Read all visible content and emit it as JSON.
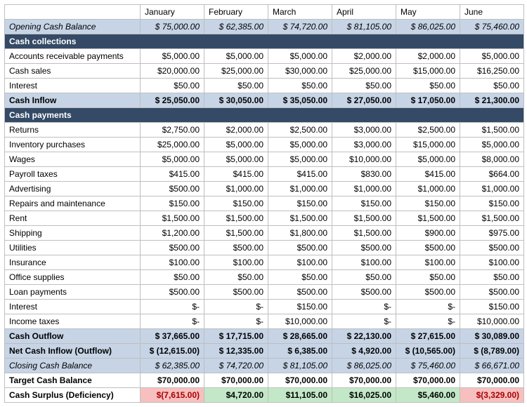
{
  "months": [
    "January",
    "February",
    "March",
    "April",
    "May",
    "June"
  ],
  "rows": {
    "opening": {
      "label": "Opening Cash Balance",
      "vals": [
        "$  75,000.00",
        "$  62,385.00",
        "$  74,720.00",
        "$  81,105.00",
        "$  86,025.00",
        "$  75,460.00"
      ]
    },
    "sec_collect": {
      "label": "Cash collections"
    },
    "ar": {
      "label": "Accounts receivable payments",
      "vals": [
        "$5,000.00",
        "$5,000.00",
        "$5,000.00",
        "$2,000.00",
        "$2,000.00",
        "$5,000.00"
      ]
    },
    "cashsales": {
      "label": "Cash sales",
      "vals": [
        "$20,000.00",
        "$25,000.00",
        "$30,000.00",
        "$25,000.00",
        "$15,000.00",
        "$16,250.00"
      ]
    },
    "interest_in": {
      "label": "Interest",
      "vals": [
        "$50.00",
        "$50.00",
        "$50.00",
        "$50.00",
        "$50.00",
        "$50.00"
      ]
    },
    "inflow": {
      "label": "Cash Inflow",
      "vals": [
        "$  25,050.00",
        "$  30,050.00",
        "$   35,050.00",
        "$   27,050.00",
        "$   17,050.00",
        "$   21,300.00"
      ]
    },
    "sec_pay": {
      "label": "Cash payments"
    },
    "returns": {
      "label": "Returns",
      "vals": [
        "$2,750.00",
        "$2,000.00",
        "$2,500.00",
        "$3,000.00",
        "$2,500.00",
        "$1,500.00"
      ]
    },
    "inventory": {
      "label": "Inventory purchases",
      "vals": [
        "$25,000.00",
        "$5,000.00",
        "$5,000.00",
        "$3,000.00",
        "$15,000.00",
        "$5,000.00"
      ]
    },
    "wages": {
      "label": "Wages",
      "vals": [
        "$5,000.00",
        "$5,000.00",
        "$5,000.00",
        "$10,000.00",
        "$5,000.00",
        "$8,000.00"
      ]
    },
    "payroll": {
      "label": "Payroll taxes",
      "vals": [
        "$415.00",
        "$415.00",
        "$415.00",
        "$830.00",
        "$415.00",
        "$664.00"
      ]
    },
    "adv": {
      "label": "Advertising",
      "vals": [
        "$500.00",
        "$1,000.00",
        "$1,000.00",
        "$1,000.00",
        "$1,000.00",
        "$1,000.00"
      ]
    },
    "repairs": {
      "label": "Repairs and maintenance",
      "vals": [
        "$150.00",
        "$150.00",
        "$150.00",
        "$150.00",
        "$150.00",
        "$150.00"
      ]
    },
    "rent": {
      "label": "Rent",
      "vals": [
        "$1,500.00",
        "$1,500.00",
        "$1,500.00",
        "$1,500.00",
        "$1,500.00",
        "$1,500.00"
      ]
    },
    "shipping": {
      "label": "Shipping",
      "vals": [
        "$1,200.00",
        "$1,500.00",
        "$1,800.00",
        "$1,500.00",
        "$900.00",
        "$975.00"
      ]
    },
    "util": {
      "label": "Utilities",
      "vals": [
        "$500.00",
        "$500.00",
        "$500.00",
        "$500.00",
        "$500.00",
        "$500.00"
      ]
    },
    "ins": {
      "label": "Insurance",
      "vals": [
        "$100.00",
        "$100.00",
        "$100.00",
        "$100.00",
        "$100.00",
        "$100.00"
      ]
    },
    "office": {
      "label": "Office supplies",
      "vals": [
        "$50.00",
        "$50.00",
        "$50.00",
        "$50.00",
        "$50.00",
        "$50.00"
      ]
    },
    "loan": {
      "label": "Loan payments",
      "vals": [
        "$500.00",
        "$500.00",
        "$500.00",
        "$500.00",
        "$500.00",
        "$500.00"
      ]
    },
    "interest_out": {
      "label": "Interest",
      "vals": [
        "$-",
        "$-",
        "$150.00",
        "$-",
        "$-",
        "$150.00"
      ]
    },
    "inctax": {
      "label": "Income taxes",
      "vals": [
        "$-",
        "$-",
        "$10,000.00",
        "$-",
        "$-",
        "$10,000.00"
      ]
    },
    "outflow": {
      "label": "Cash Outflow",
      "vals": [
        "$  37,665.00",
        "$  17,715.00",
        "$   28,665.00",
        "$   22,130.00",
        "$   27,615.00",
        "$   30,089.00"
      ]
    },
    "netinflow": {
      "label": "Net Cash Inflow (Outflow)",
      "vals": [
        "$ (12,615.00)",
        "$  12,335.00",
        "$    6,385.00",
        "$    4,920.00",
        "$  (10,565.00)",
        "$   (8,789.00)"
      ]
    },
    "closing": {
      "label": "Closing Cash Balance",
      "vals": [
        "$  62,385.00",
        "$  74,720.00",
        "$  81,105.00",
        "$  86,025.00",
        "$  75,460.00",
        "$  66,671.00"
      ]
    },
    "target": {
      "label": "Target Cash Balance",
      "vals": [
        "$70,000.00",
        "$70,000.00",
        "$70,000.00",
        "$70,000.00",
        "$70,000.00",
        "$70,000.00"
      ]
    },
    "surplus": {
      "label": "Cash Surplus (Deficiency)",
      "vals": [
        "$(7,615.00)",
        "$4,720.00",
        "$11,105.00",
        "$16,025.00",
        "$5,460.00",
        "$(3,329.00)"
      ],
      "cls": [
        "neg-red",
        "pos-grn",
        "pos-grn",
        "pos-grn",
        "pos-grn",
        "neg-red"
      ]
    }
  }
}
